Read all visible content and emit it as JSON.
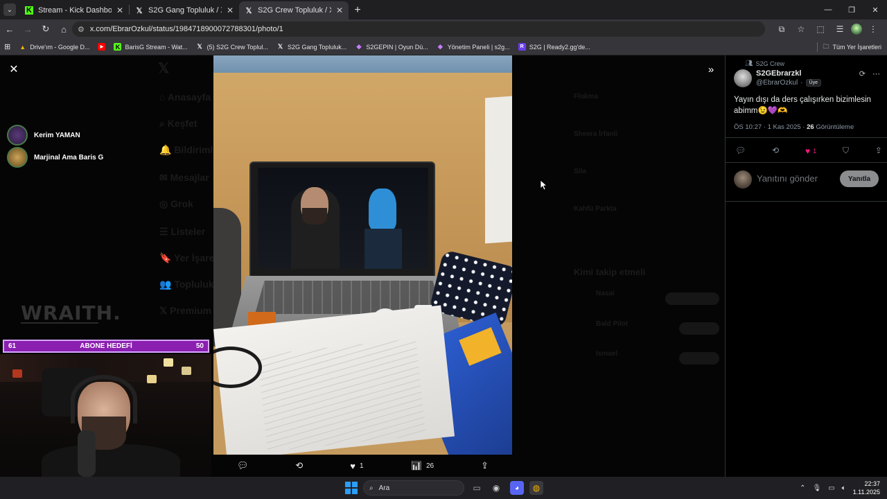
{
  "browser": {
    "tabs": [
      {
        "label": "Stream - Kick Dashboard",
        "icon": "kick-icon",
        "active": false
      },
      {
        "label": "S2G Gang Topluluk / X",
        "icon": "x-icon",
        "active": false
      },
      {
        "label": "S2G Crew Topluluk / X",
        "icon": "x-icon",
        "active": true
      }
    ],
    "url": "x.com/EbrarOzkul/status/1984718900072788301/photo/1",
    "bookmarks": [
      {
        "label": "Drive'ım - Google D...",
        "icon": "drive-icon",
        "color": "#f4b400"
      },
      {
        "label": "",
        "icon": "youtube-icon",
        "color": "#ff0000"
      },
      {
        "label": "BarisG Stream - Wat...",
        "icon": "kick-icon",
        "color": "#53fc18"
      },
      {
        "label": "(5) S2G Crew Toplul...",
        "icon": "x-icon",
        "color": "#000000"
      },
      {
        "label": "S2G Gang Topluluk...",
        "icon": "x-icon",
        "color": "#000000"
      },
      {
        "label": "S2GEPIN | Oyun Dü...",
        "icon": "s2g-icon",
        "color": "#8a2be2"
      },
      {
        "label": "Yönetim Paneli | s2g...",
        "icon": "s2g-icon",
        "color": "#8a2be2"
      },
      {
        "label": "S2G | Ready2.gg'de...",
        "icon": "ready2-icon",
        "color": "#6a3df0"
      }
    ],
    "all_bookmarks_label": "Tüm Yer İşaretleri"
  },
  "stream_overlay": {
    "viewers": [
      "Kerim YAMAN",
      "Marjinal Ama Baris G"
    ],
    "brand_text": "WRAITH.",
    "goal": {
      "label": "ABONE HEDEFİ",
      "current": "61",
      "target": "50"
    }
  },
  "photo_actions": {
    "likes": "1",
    "views": "26"
  },
  "tweet": {
    "community": "S2G Crew",
    "author_name": "S2GEbrarzkl",
    "author_handle": "@EbrarOzkul",
    "badge": "Üye",
    "text": "Yayın dışı da ders çalışırken bizimlesin abimm😉💜🫶",
    "time": "ÖS 10:27 · 1 Kas 2025 · ",
    "view_count": "26",
    "view_label": "Görüntüleme",
    "likes": "1",
    "reply_placeholder": "Yanıtını gönder",
    "reply_button": "Yanıtla"
  },
  "taskbar": {
    "search_placeholder": "Ara",
    "time": "22:37",
    "date": "1.11.2025"
  },
  "colors": {
    "goal_bg": "#8a1fb0",
    "like_pink": "#f91880",
    "start_blue": "#2b9ef6"
  }
}
